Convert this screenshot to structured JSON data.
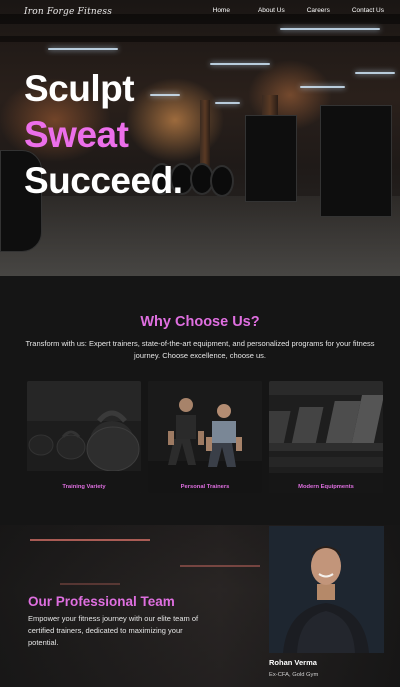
{
  "brand": {
    "logo_text": "Iron Forge Fitness"
  },
  "nav": {
    "links": [
      {
        "label": "Home"
      },
      {
        "label": "About Us"
      },
      {
        "label": "Careers"
      },
      {
        "label": "Contact Us"
      }
    ]
  },
  "hero": {
    "line1": "Sculpt",
    "line2": "Sweat",
    "line3": "Succeed."
  },
  "why": {
    "title": "Why Choose Us?",
    "description": "Transform with us: Expert trainers, state-of-the-art equipment, and personalized programs for your fitness journey. Choose excellence, choose us.",
    "cards": [
      {
        "label": "Training Variety"
      },
      {
        "label": "Personal Trainers"
      },
      {
        "label": "Modern Equipments"
      }
    ]
  },
  "team": {
    "title": "Our Professional Team",
    "description": "Empower your fitness journey with our elite team of certified trainers, dedicated to maximizing your potential.",
    "trainer": {
      "name": "Rohan Verma",
      "role": "Ex-CFA, Gold Gym"
    }
  },
  "colors": {
    "accent": "#df6fe0",
    "hero_accent": "#ec6fea",
    "background": "#151515"
  }
}
